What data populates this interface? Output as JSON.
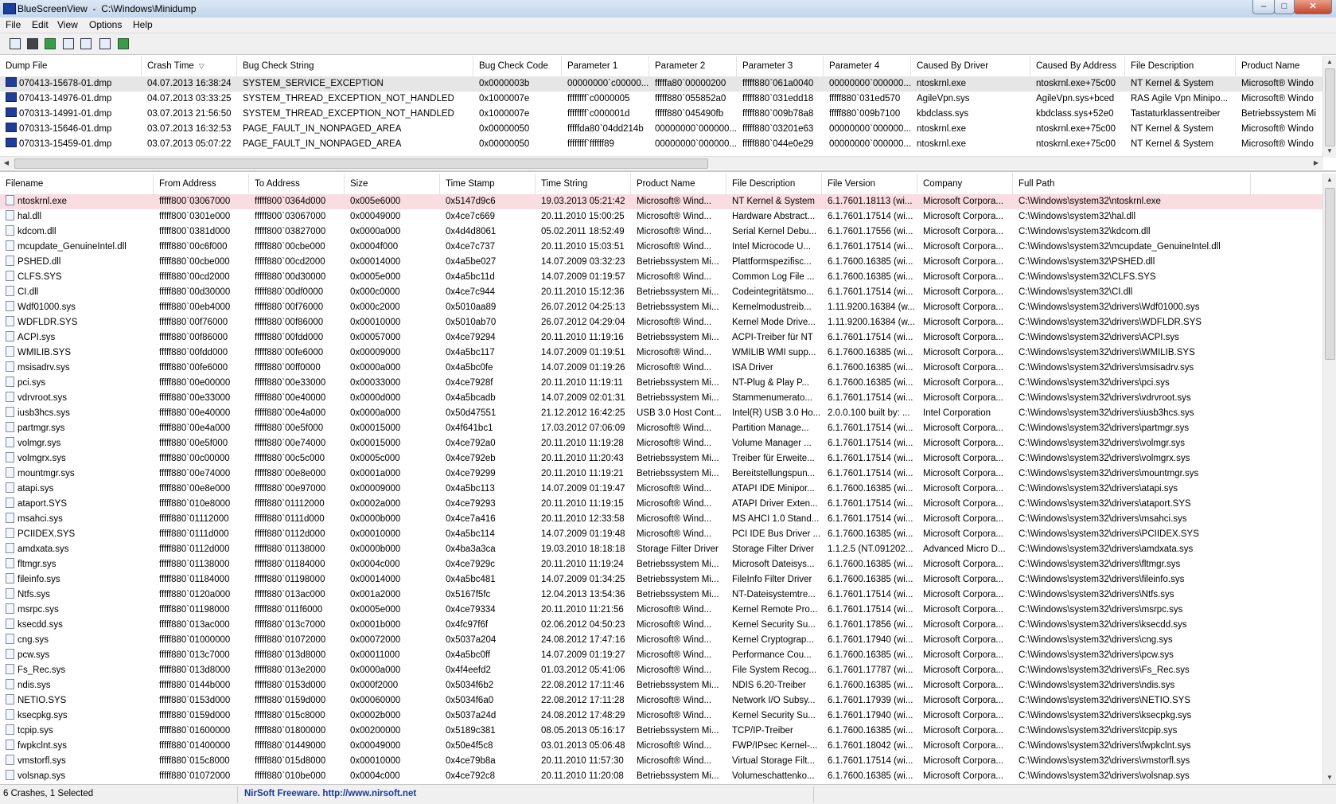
{
  "titlebar": {
    "app_title": "BlueScreenView",
    "path": "C:\\Windows\\Minidump",
    "minimize": "–",
    "maximize": "□",
    "close": "✕"
  },
  "menu": [
    "File",
    "Edit",
    "View",
    "Options",
    "Help"
  ],
  "toolbar_icons": [
    "properties-icon",
    "save-icon",
    "refresh-icon",
    "copy-icon",
    "advanced-options-icon",
    "find-icon",
    "exit-icon"
  ],
  "upper": {
    "columns": [
      "Dump File",
      "Crash Time",
      "Bug Check String",
      "Bug Check Code",
      "Parameter 1",
      "Parameter 2",
      "Parameter 3",
      "Parameter 4",
      "Caused By Driver",
      "Caused By Address",
      "File Description",
      "Product Name"
    ],
    "sort_indicator": "▽",
    "rows": [
      [
        "070413-15678-01.dmp",
        "04.07.2013 16:38:24",
        "SYSTEM_SERVICE_EXCEPTION",
        "0x0000003b",
        "00000000`c00000...",
        "fffffa80`00000200",
        "fffff880`061a0040",
        "00000000`000000...",
        "ntoskrnl.exe",
        "ntoskrnl.exe+75c00",
        "NT Kernel & System",
        "Microsoft® Windo"
      ],
      [
        "070413-14976-01.dmp",
        "04.07.2013 03:33:25",
        "SYSTEM_THREAD_EXCEPTION_NOT_HANDLED",
        "0x1000007e",
        "ffffffff`c0000005",
        "fffff880`055852a0",
        "fffff880`031edd18",
        "fffff880`031ed570",
        "AgileVpn.sys",
        "AgileVpn.sys+bced",
        "RAS Agile Vpn Minipo...",
        "Microsoft® Windo"
      ],
      [
        "070313-14991-01.dmp",
        "03.07.2013 21:56:50",
        "SYSTEM_THREAD_EXCEPTION_NOT_HANDLED",
        "0x1000007e",
        "ffffffff`c000001d",
        "fffff880`045490fb",
        "fffff880`009b78a8",
        "fffff880`009b7100",
        "kbdclass.sys",
        "kbdclass.sys+52e0",
        "Tastaturklassentreiber",
        "Betriebssystem Mi"
      ],
      [
        "070313-15646-01.dmp",
        "03.07.2013 16:32:53",
        "PAGE_FAULT_IN_NONPAGED_AREA",
        "0x00000050",
        "fffffda80`04dd214b",
        "00000000`000000...",
        "fffff880`03201e63",
        "00000000`000000...",
        "ntoskrnl.exe",
        "ntoskrnl.exe+75c00",
        "NT Kernel & System",
        "Microsoft® Windo"
      ],
      [
        "070313-15459-01.dmp",
        "03.07.2013 05:07:22",
        "PAGE_FAULT_IN_NONPAGED_AREA",
        "0x00000050",
        "ffffffff`ffffff89",
        "00000000`000000...",
        "fffff880`044e0e29",
        "00000000`000000...",
        "ntoskrnl.exe",
        "ntoskrnl.exe+75c00",
        "NT Kernel & System",
        "Microsoft® Windo"
      ]
    ],
    "scroll_left": "◀",
    "scroll_right": "▶",
    "scroll_up": "▲",
    "scroll_down": "▼"
  },
  "lower": {
    "columns": [
      "Filename",
      "From Address",
      "To Address",
      "Size",
      "Time Stamp",
      "Time String",
      "Product Name",
      "File Description",
      "File Version",
      "Company",
      "Full Path"
    ],
    "rows": [
      [
        "ntoskrnl.exe",
        "fffff800`03067000",
        "fffff800`0364d000",
        "0x005e6000",
        "0x5147d9c6",
        "19.03.2013 05:21:42",
        "Microsoft® Wind...",
        "NT Kernel & System",
        "6.1.7601.18113 (wi...",
        "Microsoft Corpora...",
        "C:\\Windows\\system32\\ntoskrnl.exe"
      ],
      [
        "hal.dll",
        "fffff800`0301e000",
        "fffff800`03067000",
        "0x00049000",
        "0x4ce7c669",
        "20.11.2010 15:00:25",
        "Microsoft® Wind...",
        "Hardware Abstract...",
        "6.1.7601.17514 (wi...",
        "Microsoft Corpora...",
        "C:\\Windows\\system32\\hal.dll"
      ],
      [
        "kdcom.dll",
        "fffff800`0381d000",
        "fffff800`03827000",
        "0x0000a000",
        "0x4d4d8061",
        "05.02.2011 18:52:49",
        "Microsoft® Wind...",
        "Serial Kernel Debu...",
        "6.1.7601.17556 (wi...",
        "Microsoft Corpora...",
        "C:\\Windows\\system32\\kdcom.dll"
      ],
      [
        "mcupdate_GenuineIntel.dll",
        "fffff880`00c6f000",
        "fffff880`00cbe000",
        "0x0004f000",
        "0x4ce7c737",
        "20.11.2010 15:03:51",
        "Microsoft® Wind...",
        "Intel Microcode U...",
        "6.1.7601.17514 (wi...",
        "Microsoft Corpora...",
        "C:\\Windows\\system32\\mcupdate_GenuineIntel.dll"
      ],
      [
        "PSHED.dll",
        "fffff880`00cbe000",
        "fffff880`00cd2000",
        "0x00014000",
        "0x4a5be027",
        "14.07.2009 03:32:23",
        "Betriebssystem Mi...",
        "Plattformspezifisc...",
        "6.1.7600.16385 (wi...",
        "Microsoft Corpora...",
        "C:\\Windows\\system32\\PSHED.dll"
      ],
      [
        "CLFS.SYS",
        "fffff880`00cd2000",
        "fffff880`00d30000",
        "0x0005e000",
        "0x4a5bc11d",
        "14.07.2009 01:19:57",
        "Microsoft® Wind...",
        "Common Log File ...",
        "6.1.7600.16385 (wi...",
        "Microsoft Corpora...",
        "C:\\Windows\\system32\\CLFS.SYS"
      ],
      [
        "CI.dll",
        "fffff880`00d30000",
        "fffff880`00df0000",
        "0x000c0000",
        "0x4ce7c944",
        "20.11.2010 15:12:36",
        "Betriebssystem Mi...",
        "Codeintegritätsmo...",
        "6.1.7601.17514 (wi...",
        "Microsoft Corpora...",
        "C:\\Windows\\system32\\CI.dll"
      ],
      [
        "Wdf01000.sys",
        "fffff880`00eb4000",
        "fffff880`00f76000",
        "0x000c2000",
        "0x5010aa89",
        "26.07.2012 04:25:13",
        "Betriebssystem Mi...",
        "Kernelmodustreib...",
        "1.11.9200.16384 (w...",
        "Microsoft Corpora...",
        "C:\\Windows\\system32\\drivers\\Wdf01000.sys"
      ],
      [
        "WDFLDR.SYS",
        "fffff880`00f76000",
        "fffff880`00f86000",
        "0x00010000",
        "0x5010ab70",
        "26.07.2012 04:29:04",
        "Microsoft® Wind...",
        "Kernel Mode Drive...",
        "1.11.9200.16384 (w...",
        "Microsoft Corpora...",
        "C:\\Windows\\system32\\drivers\\WDFLDR.SYS"
      ],
      [
        "ACPI.sys",
        "fffff880`00f86000",
        "fffff880`00fdd000",
        "0x00057000",
        "0x4ce79294",
        "20.11.2010 11:19:16",
        "Betriebssystem Mi...",
        "ACPI-Treiber für NT",
        "6.1.7601.17514 (wi...",
        "Microsoft Corpora...",
        "C:\\Windows\\system32\\drivers\\ACPI.sys"
      ],
      [
        "WMILIB.SYS",
        "fffff880`00fdd000",
        "fffff880`00fe6000",
        "0x00009000",
        "0x4a5bc117",
        "14.07.2009 01:19:51",
        "Microsoft® Wind...",
        "WMILIB WMI supp...",
        "6.1.7600.16385 (wi...",
        "Microsoft Corpora...",
        "C:\\Windows\\system32\\drivers\\WMILIB.SYS"
      ],
      [
        "msisadrv.sys",
        "fffff880`00fe6000",
        "fffff880`00ff0000",
        "0x0000a000",
        "0x4a5bc0fe",
        "14.07.2009 01:19:26",
        "Microsoft® Wind...",
        "ISA Driver",
        "6.1.7600.16385 (wi...",
        "Microsoft Corpora...",
        "C:\\Windows\\system32\\drivers\\msisadrv.sys"
      ],
      [
        "pci.sys",
        "fffff880`00e00000",
        "fffff880`00e33000",
        "0x00033000",
        "0x4ce7928f",
        "20.11.2010 11:19:11",
        "Betriebssystem Mi...",
        "NT-Plug & Play P...",
        "6.1.7600.16385 (wi...",
        "Microsoft Corpora...",
        "C:\\Windows\\system32\\drivers\\pci.sys"
      ],
      [
        "vdrvroot.sys",
        "fffff880`00e33000",
        "fffff880`00e40000",
        "0x0000d000",
        "0x4a5bcadb",
        "14.07.2009 02:01:31",
        "Betriebssystem Mi...",
        "Stammenumerato...",
        "6.1.7601.17514 (wi...",
        "Microsoft Corpora...",
        "C:\\Windows\\system32\\drivers\\vdrvroot.sys"
      ],
      [
        "iusb3hcs.sys",
        "fffff880`00e40000",
        "fffff880`00e4a000",
        "0x0000a000",
        "0x50d47551",
        "21.12.2012 16:42:25",
        "USB 3.0 Host Cont...",
        "Intel(R) USB 3.0 Ho...",
        "2.0.0.100 built by: ...",
        "Intel Corporation",
        "C:\\Windows\\system32\\drivers\\iusb3hcs.sys"
      ],
      [
        "partmgr.sys",
        "fffff880`00e4a000",
        "fffff880`00e5f000",
        "0x00015000",
        "0x4f641bc1",
        "17.03.2012 07:06:09",
        "Microsoft® Wind...",
        "Partition Manage...",
        "6.1.7601.17514 (wi...",
        "Microsoft Corpora...",
        "C:\\Windows\\system32\\drivers\\partmgr.sys"
      ],
      [
        "volmgr.sys",
        "fffff880`00e5f000",
        "fffff880`00e74000",
        "0x00015000",
        "0x4ce792a0",
        "20.11.2010 11:19:28",
        "Microsoft® Wind...",
        "Volume Manager ...",
        "6.1.7601.17514 (wi...",
        "Microsoft Corpora...",
        "C:\\Windows\\system32\\drivers\\volmgr.sys"
      ],
      [
        "volmgrx.sys",
        "fffff880`00c00000",
        "fffff880`00c5c000",
        "0x0005c000",
        "0x4ce792eb",
        "20.11.2010 11:20:43",
        "Betriebssystem Mi...",
        "Treiber für Erweite...",
        "6.1.7601.17514 (wi...",
        "Microsoft Corpora...",
        "C:\\Windows\\system32\\drivers\\volmgrx.sys"
      ],
      [
        "mountmgr.sys",
        "fffff880`00e74000",
        "fffff880`00e8e000",
        "0x0001a000",
        "0x4ce79299",
        "20.11.2010 11:19:21",
        "Betriebssystem Mi...",
        "Bereitstellungspun...",
        "6.1.7601.17514 (wi...",
        "Microsoft Corpora...",
        "C:\\Windows\\system32\\drivers\\mountmgr.sys"
      ],
      [
        "atapi.sys",
        "fffff880`00e8e000",
        "fffff880`00e97000",
        "0x00009000",
        "0x4a5bc113",
        "14.07.2009 01:19:47",
        "Microsoft® Wind...",
        "ATAPI IDE Minipor...",
        "6.1.7600.16385 (wi...",
        "Microsoft Corpora...",
        "C:\\Windows\\system32\\drivers\\atapi.sys"
      ],
      [
        "ataport.SYS",
        "fffff880`010e8000",
        "fffff880`01112000",
        "0x0002a000",
        "0x4ce79293",
        "20.11.2010 11:19:15",
        "Microsoft® Wind...",
        "ATAPI Driver Exten...",
        "6.1.7601.17514 (wi...",
        "Microsoft Corpora...",
        "C:\\Windows\\system32\\drivers\\ataport.SYS"
      ],
      [
        "msahci.sys",
        "fffff880`01112000",
        "fffff880`0111d000",
        "0x0000b000",
        "0x4ce7a416",
        "20.11.2010 12:33:58",
        "Microsoft® Wind...",
        "MS AHCI 1.0 Stand...",
        "6.1.7601.17514 (wi...",
        "Microsoft Corpora...",
        "C:\\Windows\\system32\\drivers\\msahci.sys"
      ],
      [
        "PCIIDEX.SYS",
        "fffff880`0111d000",
        "fffff880`0112d000",
        "0x00010000",
        "0x4a5bc114",
        "14.07.2009 01:19:48",
        "Microsoft® Wind...",
        "PCI IDE Bus Driver ...",
        "6.1.7600.16385 (wi...",
        "Microsoft Corpora...",
        "C:\\Windows\\system32\\drivers\\PCIIDEX.SYS"
      ],
      [
        "amdxata.sys",
        "fffff880`0112d000",
        "fffff880`01138000",
        "0x0000b000",
        "0x4ba3a3ca",
        "19.03.2010 18:18:18",
        "Storage Filter Driver",
        "Storage Filter Driver",
        "1.1.2.5 (NT.091202...",
        "Advanced Micro D...",
        "C:\\Windows\\system32\\drivers\\amdxata.sys"
      ],
      [
        "fltmgr.sys",
        "fffff880`01138000",
        "fffff880`01184000",
        "0x0004c000",
        "0x4ce7929c",
        "20.11.2010 11:19:24",
        "Betriebssystem Mi...",
        "Microsoft Dateisys...",
        "6.1.7600.16385 (wi...",
        "Microsoft Corpora...",
        "C:\\Windows\\system32\\drivers\\fltmgr.sys"
      ],
      [
        "fileinfo.sys",
        "fffff880`01184000",
        "fffff880`01198000",
        "0x00014000",
        "0x4a5bc481",
        "14.07.2009 01:34:25",
        "Betriebssystem Mi...",
        "FileInfo Filter Driver",
        "6.1.7600.16385 (wi...",
        "Microsoft Corpora...",
        "C:\\Windows\\system32\\drivers\\fileinfo.sys"
      ],
      [
        "Ntfs.sys",
        "fffff880`0120a000",
        "fffff880`013ac000",
        "0x001a2000",
        "0x5167f5fc",
        "12.04.2013 13:54:36",
        "Betriebssystem Mi...",
        "NT-Dateisystemtre...",
        "6.1.7601.17514 (wi...",
        "Microsoft Corpora...",
        "C:\\Windows\\system32\\drivers\\Ntfs.sys"
      ],
      [
        "msrpc.sys",
        "fffff880`01198000",
        "fffff880`011f6000",
        "0x0005e000",
        "0x4ce79334",
        "20.11.2010 11:21:56",
        "Microsoft® Wind...",
        "Kernel Remote Pro...",
        "6.1.7601.17514 (wi...",
        "Microsoft Corpora...",
        "C:\\Windows\\system32\\drivers\\msrpc.sys"
      ],
      [
        "ksecdd.sys",
        "fffff880`013ac000",
        "fffff880`013c7000",
        "0x0001b000",
        "0x4fc97f6f",
        "02.06.2012 04:50:23",
        "Microsoft® Wind...",
        "Kernel Security Su...",
        "6.1.7601.17856 (wi...",
        "Microsoft Corpora...",
        "C:\\Windows\\system32\\drivers\\ksecdd.sys"
      ],
      [
        "cng.sys",
        "fffff880`01000000",
        "fffff880`01072000",
        "0x00072000",
        "0x5037a204",
        "24.08.2012 17:47:16",
        "Microsoft® Wind...",
        "Kernel Cryptograp...",
        "6.1.7601.17940 (wi...",
        "Microsoft Corpora...",
        "C:\\Windows\\system32\\drivers\\cng.sys"
      ],
      [
        "pcw.sys",
        "fffff880`013c7000",
        "fffff880`013d8000",
        "0x00011000",
        "0x4a5bc0ff",
        "14.07.2009 01:19:27",
        "Microsoft® Wind...",
        "Performance Cou...",
        "6.1.7600.16385 (wi...",
        "Microsoft Corpora...",
        "C:\\Windows\\system32\\drivers\\pcw.sys"
      ],
      [
        "Fs_Rec.sys",
        "fffff880`013d8000",
        "fffff880`013e2000",
        "0x0000a000",
        "0x4f4eefd2",
        "01.03.2012 05:41:06",
        "Microsoft® Wind...",
        "File System Recog...",
        "6.1.7601.17787 (wi...",
        "Microsoft Corpora...",
        "C:\\Windows\\system32\\drivers\\Fs_Rec.sys"
      ],
      [
        "ndis.sys",
        "fffff880`0144b000",
        "fffff880`0153d000",
        "0x000f2000",
        "0x5034f6b2",
        "22.08.2012 17:11:46",
        "Betriebssystem Mi...",
        "NDIS 6.20-Treiber",
        "6.1.7600.16385 (wi...",
        "Microsoft Corpora...",
        "C:\\Windows\\system32\\drivers\\ndis.sys"
      ],
      [
        "NETIO.SYS",
        "fffff880`0153d000",
        "fffff880`0159d000",
        "0x00060000",
        "0x5034f6a0",
        "22.08.2012 17:11:28",
        "Microsoft® Wind...",
        "Network I/O Subsy...",
        "6.1.7601.17939 (wi...",
        "Microsoft Corpora...",
        "C:\\Windows\\system32\\drivers\\NETIO.SYS"
      ],
      [
        "ksecpkg.sys",
        "fffff880`0159d000",
        "fffff880`015c8000",
        "0x0002b000",
        "0x5037a24d",
        "24.08.2012 17:48:29",
        "Microsoft® Wind...",
        "Kernel Security Su...",
        "6.1.7601.17940 (wi...",
        "Microsoft Corpora...",
        "C:\\Windows\\system32\\drivers\\ksecpkg.sys"
      ],
      [
        "tcpip.sys",
        "fffff880`01600000",
        "fffff880`01800000",
        "0x00200000",
        "0x5189c381",
        "08.05.2013 05:16:17",
        "Betriebssystem Mi...",
        "TCP/IP-Treiber",
        "6.1.7600.16385 (wi...",
        "Microsoft Corpora...",
        "C:\\Windows\\system32\\drivers\\tcpip.sys"
      ],
      [
        "fwpkclnt.sys",
        "fffff880`01400000",
        "fffff880`01449000",
        "0x00049000",
        "0x50e4f5c8",
        "03.01.2013 05:06:48",
        "Microsoft® Wind...",
        "FWP/IPsec Kernel-...",
        "6.1.7601.18042 (wi...",
        "Microsoft Corpora...",
        "C:\\Windows\\system32\\drivers\\fwpkclnt.sys"
      ],
      [
        "vmstorfl.sys",
        "fffff880`015c8000",
        "fffff880`015d8000",
        "0x00010000",
        "0x4ce79b8a",
        "20.11.2010 11:57:30",
        "Microsoft® Wind...",
        "Virtual Storage Filt...",
        "6.1.7601.17514 (wi...",
        "Microsoft Corpora...",
        "C:\\Windows\\system32\\drivers\\vmstorfl.sys"
      ],
      [
        "volsnap.sys",
        "fffff880`01072000",
        "fffff880`010be000",
        "0x0004c000",
        "0x4ce792c8",
        "20.11.2010 11:20:08",
        "Betriebssystem Mi...",
        "Volumeschattenko...",
        "6.1.7600.16385 (wi...",
        "Microsoft Corpora...",
        "C:\\Windows\\system32\\drivers\\volsnap.sys"
      ]
    ]
  },
  "status": {
    "count": "6 Crashes, 1 Selected",
    "freeware": "NirSoft Freeware.  http://www.nirsoft.net"
  },
  "colors": {
    "selected_upper": "#e6e6e6",
    "selected_lower": "#f9dde0",
    "link": "#1c3a93"
  }
}
